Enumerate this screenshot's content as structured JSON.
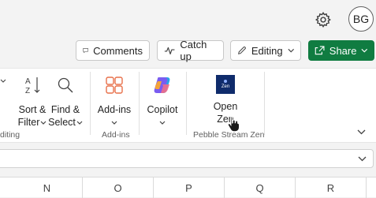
{
  "header": {
    "avatar_initials": "BG",
    "buttons": {
      "comments": "Comments",
      "catch_up": "Catch up",
      "editing": "Editing",
      "share": "Share"
    }
  },
  "ribbon": {
    "sort_filter": {
      "line1": "Sort &",
      "line2": "Filter"
    },
    "find_select": {
      "line1": "Find &",
      "line2": "Select"
    },
    "add_ins": {
      "label": "Add-ins"
    },
    "copilot": {
      "label": "Copilot"
    },
    "open_zen": {
      "line1": "Open",
      "line2": "Zen"
    },
    "groups": {
      "editing_partial": "diting",
      "add_ins": "Add-ins",
      "pebble": "Pebble Stream Zen"
    },
    "zen_icon_text": "Zen"
  },
  "grid": {
    "columns": [
      "N",
      "O",
      "P",
      "Q",
      "R"
    ]
  },
  "colors": {
    "share_green": "#107c41",
    "addins_orange": "#e8704a"
  }
}
